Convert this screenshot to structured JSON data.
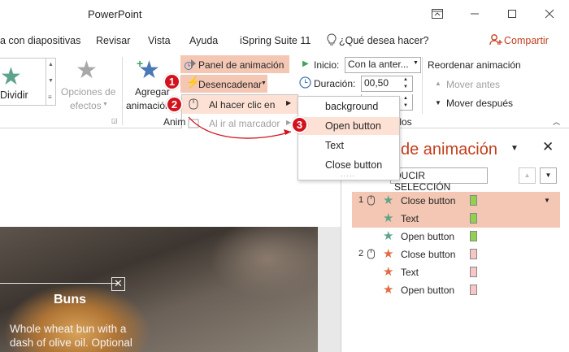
{
  "app": {
    "title": "PowerPoint"
  },
  "menu": [
    "a con diapositivas",
    "Revisar",
    "Vista",
    "Ayuda",
    "iSpring Suite 11",
    "¿Qué desea hacer?",
    "Compartir"
  ],
  "ribbon": {
    "dividir": "Dividir",
    "opciones_line1": "Opciones de",
    "opciones_line2": "efectos",
    "agregar_line1": "Agregar",
    "agregar_line2": "animación",
    "panel_animacion": "Panel de animación",
    "desencadenar": "Desencadenar",
    "al_hacer_clic": "Al hacer clic en",
    "al_ir_marcador": "Al ir al marcador",
    "group_anim": "Anim",
    "inicio_label": "Inicio:",
    "inicio_value": "Con la anter...",
    "duracion_label": "Duración:",
    "duracion_value": "00,50",
    "intervalos": "ervalos",
    "reordenar": "Reordenar animación",
    "mover_antes": "Mover antes",
    "mover_despues": "Mover después"
  },
  "trigger_menu": [
    "background",
    "Open button",
    "Text",
    "Close button"
  ],
  "callouts": [
    "1",
    "2",
    "3"
  ],
  "pane": {
    "title": "de animación",
    "play_button": "DUCIR SELECCIÓN",
    "items": [
      {
        "num": "1",
        "name": "Close button",
        "star_color": "#5fa38a",
        "swatch": "#92d050"
      },
      {
        "num": "",
        "name": "Text",
        "star_color": "#5fa38a",
        "swatch": "#92d050"
      },
      {
        "num": "",
        "name": "Open button",
        "star_color": "#5fa38a",
        "swatch": "#92d050"
      },
      {
        "num": "2",
        "name": "Close button",
        "star_color": "#e26b46",
        "swatch": "#f8c6c6"
      },
      {
        "num": "",
        "name": "Text",
        "star_color": "#e26b46",
        "swatch": "#f8c6c6"
      },
      {
        "num": "",
        "name": "Open button",
        "star_color": "#e26b46",
        "swatch": "#f8c6c6"
      }
    ]
  },
  "slide": {
    "heading": "Buns",
    "body_line1": "Whole wheat bun with a",
    "body_line2": "dash of olive oil. Optional"
  },
  "colors": {
    "accent": "#c43e1c",
    "selection": "#f4c7b4",
    "callout": "#d3121e"
  }
}
